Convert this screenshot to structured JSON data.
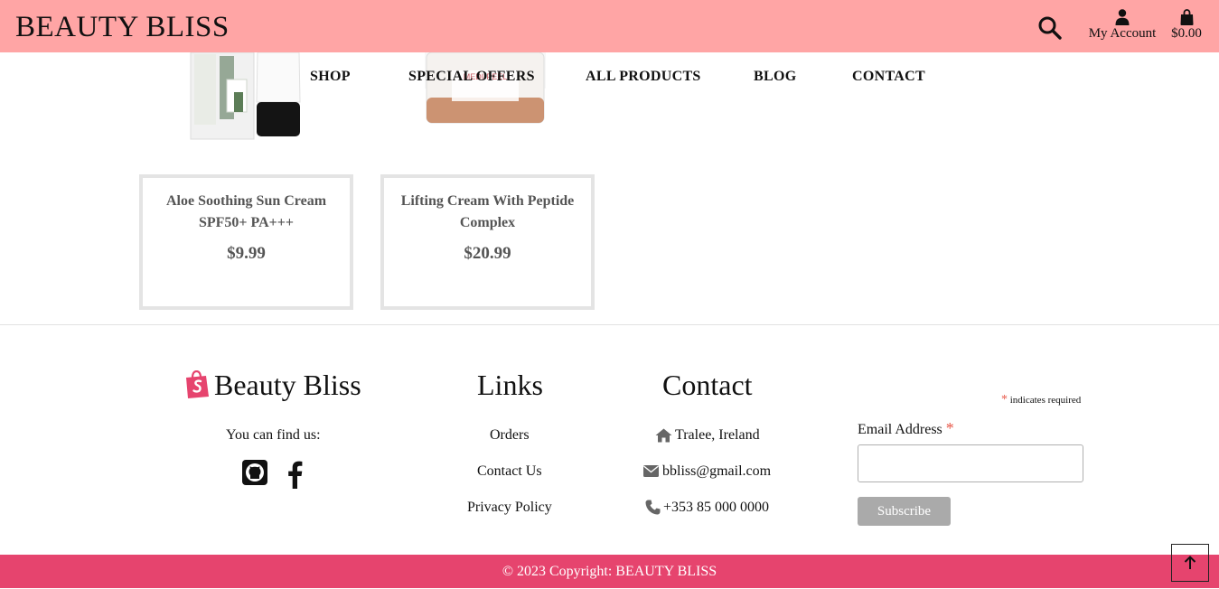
{
  "header": {
    "brand": "BEAUTY BLISS",
    "account_label": "My Account",
    "bag_total": "$0.00",
    "icons": {
      "search": "search-icon",
      "account": "user-icon",
      "bag": "shopping-bag-icon"
    }
  },
  "nav": {
    "items": [
      {
        "label": "SHOP"
      },
      {
        "label": "SPECIAL OFFERS"
      },
      {
        "label": "ALL PRODUCTS"
      },
      {
        "label": "BLOG"
      },
      {
        "label": "CONTACT"
      }
    ]
  },
  "products": [
    {
      "name": "Aloe Soothing Sun Cream SPF50+ PA+++",
      "price": "$9.99"
    },
    {
      "name": "Lifting Cream With Peptide Complex",
      "price": "$20.99"
    }
  ],
  "footer": {
    "brand": {
      "name": "Beauty Bliss",
      "find_us": "You can find us:",
      "icons": [
        "shopify-bag-icon",
        "github-icon",
        "facebook-icon"
      ]
    },
    "links": {
      "heading": "Links",
      "items": [
        "Orders",
        "Contact Us",
        "Privacy Policy"
      ]
    },
    "contact": {
      "heading": "Contact",
      "address": "Tralee, Ireland",
      "email": "bbliss@gmail.com",
      "phone": "+353 85 000 0000",
      "icons": [
        "home-icon",
        "envelope-icon",
        "phone-icon"
      ]
    },
    "newsletter": {
      "required_star": "*",
      "required_note": "indicates required",
      "email_label": "Email Address",
      "email_value": "",
      "subscribe_label": "Subscribe"
    },
    "copyright": "© 2023 Copyright: BEAUTY BLISS"
  },
  "colors": {
    "header_bg": "#ffa5a5",
    "footer_bar": "#e6446e",
    "card_border": "#e4e4e4",
    "subscribe_bg": "#aaaaaa",
    "required_star": "#e8594a",
    "shopify_icon": "#e6446e"
  }
}
